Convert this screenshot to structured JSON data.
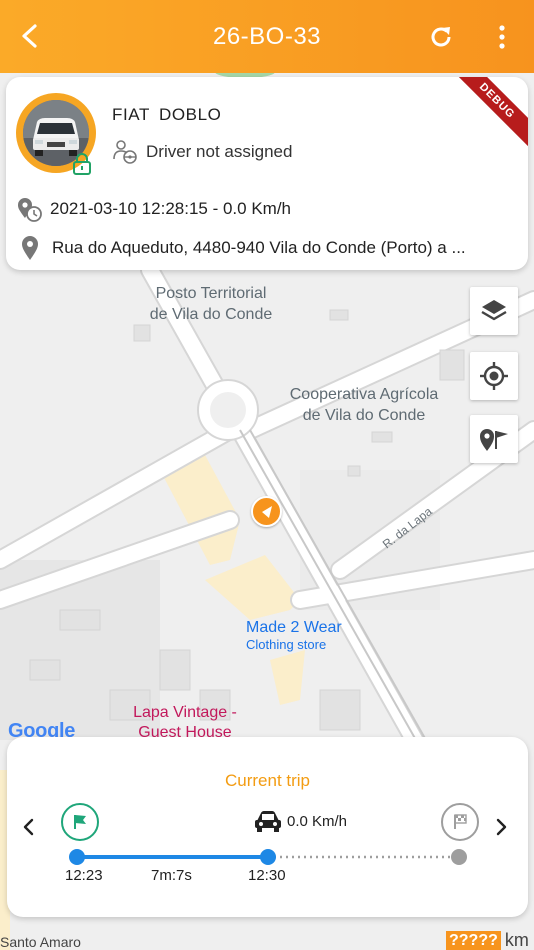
{
  "header": {
    "title": "26-BO-33"
  },
  "vehicle": {
    "brand": "FIAT",
    "model": "DOBLO",
    "name": "FIAT  DOBLO",
    "driver_status": "Driver not assigned",
    "last_update": "2021-03-10 12:28:15 - 0.0 Km/h",
    "address": "Rua do Aqueduto, 4480-940 Vila do Conde (Porto) a ...",
    "locked": true
  },
  "debug_ribbon": "DEBUG",
  "map": {
    "labels": {
      "posto": "Posto Territorial\nde Vila do Conde",
      "posto_line1": "Posto Territorial",
      "posto_line2": "de Vila do Conde",
      "coop_line1": "Cooperativa Agrícola",
      "coop_line2": "de Vila do Conde",
      "street_lapa": "R. da Lapa",
      "made2wear": "Made 2 Wear",
      "made2wear_sub": "Clothing store",
      "lapa_line1": "Lapa Vintage -",
      "lapa_line2": "Guest House",
      "santo_amaro": "Santo Amaro",
      "google": "Google"
    },
    "controls": [
      "layers-button",
      "my-location-button",
      "route-flag-button"
    ]
  },
  "trip": {
    "title": "Current trip",
    "speed": "0.0 Km/h",
    "start_time": "12:23",
    "duration": "7m:7s",
    "current_time": "12:30",
    "progress_fraction": 0.5
  },
  "odometer": {
    "value": "?????",
    "unit": "km"
  },
  "colors": {
    "accent": "#f7941d",
    "trip_title": "#f39c12",
    "timeline_blue": "#1e88e5",
    "start_flag": "#1fa67a",
    "debug_red": "#b71c1c"
  }
}
